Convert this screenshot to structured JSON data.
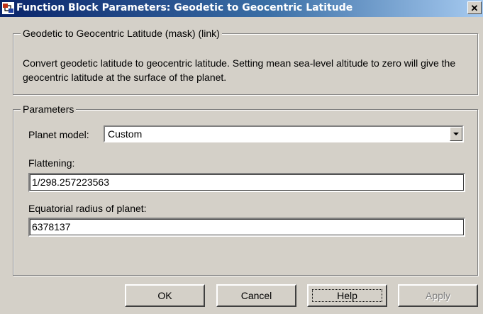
{
  "window": {
    "title": "Function Block Parameters: Geodetic to  Geocentric Latitude",
    "close_glyph": "✕"
  },
  "mask_group": {
    "legend": "Geodetic to Geocentric Latitude (mask) (link)",
    "description": "Convert geodetic latitude to geocentric latitude. Setting mean sea-level altitude to zero will give the geocentric latitude at the surface of the planet."
  },
  "parameters": {
    "legend": "Parameters",
    "planet_model_label": "Planet model:",
    "planet_model_value": "Custom",
    "flattening_label": "Flattening:",
    "flattening_value": "1/298.257223563",
    "radius_label": "Equatorial radius of planet:",
    "radius_value": "6378137"
  },
  "buttons": {
    "ok": "OK",
    "cancel": "Cancel",
    "help": "Help",
    "apply": "Apply"
  },
  "icons": {
    "app": "simulink-block-icon",
    "dropdown": "chevron-down-icon"
  }
}
